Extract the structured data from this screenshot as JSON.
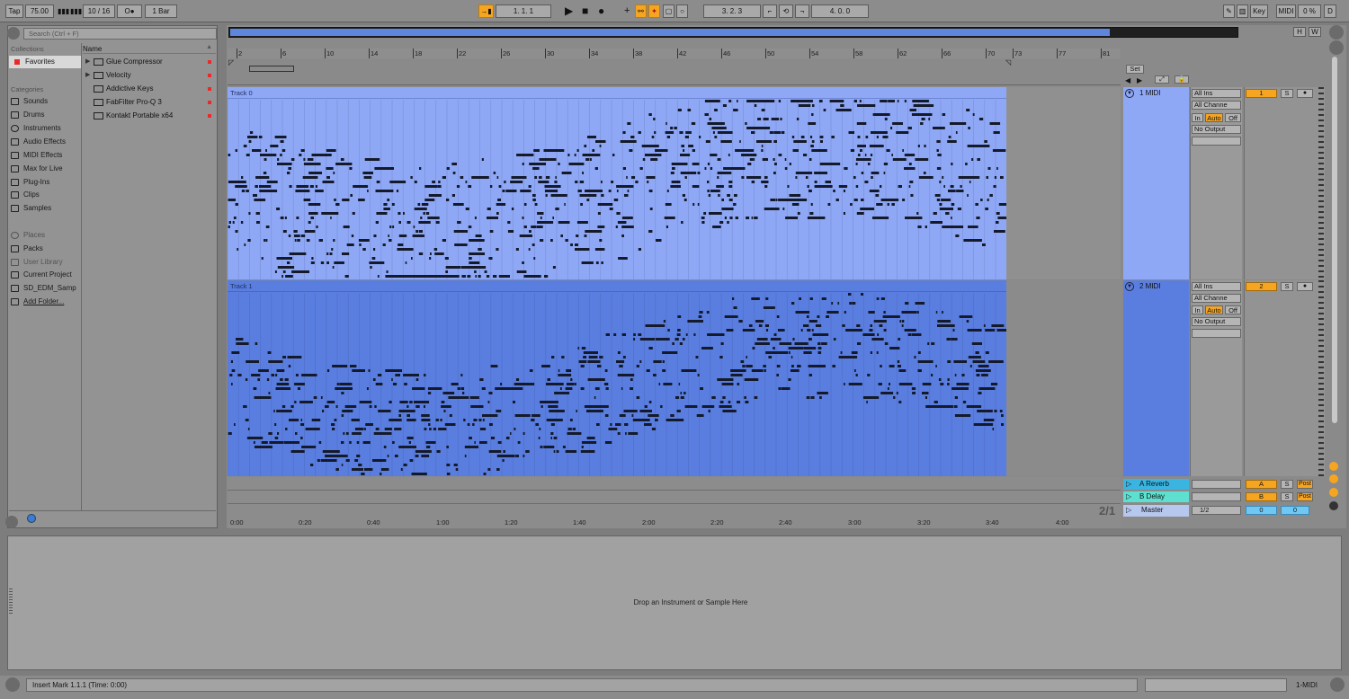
{
  "transport": {
    "tap": "Tap",
    "tempo": "75.00",
    "signature": "10 / 16",
    "metronome": "O●",
    "quantization": "1 Bar",
    "position": "1.   1.   1",
    "loop_start": "3.   2.   3",
    "loop_length": "4.   0.   0",
    "key": "Key",
    "midi": "MIDI",
    "cpu": "0 %",
    "d": "D"
  },
  "browser": {
    "search_placeholder": "Search (Ctrl + F)",
    "collections_title": "Collections",
    "favorites": "Favorites",
    "categories_title": "Categories",
    "categories": [
      "Sounds",
      "Drums",
      "Instruments",
      "Audio Effects",
      "MIDI Effects",
      "Max for Live",
      "Plug-Ins",
      "Clips",
      "Samples"
    ],
    "places_title": "Places",
    "places": [
      "Packs",
      "User Library",
      "Current Project",
      "SD_EDM_Samp",
      "Add Folder..."
    ],
    "name_header": "Name",
    "files": [
      "Glue Compressor",
      "Velocity",
      "Addictive Keys",
      "FabFilter Pro-Q 3",
      "Kontakt Portable x64"
    ]
  },
  "arrangement": {
    "bar_numbers": [
      "2",
      "6",
      "10",
      "14",
      "18",
      "22",
      "26",
      "30",
      "34",
      "38",
      "42",
      "46",
      "50",
      "54",
      "58",
      "62",
      "66",
      "70",
      "73",
      "77",
      "81"
    ],
    "time_labels": [
      "0:00",
      "0:20",
      "0:40",
      "1:00",
      "1:20",
      "1:40",
      "2:00",
      "2:20",
      "2:40",
      "3:00",
      "3:20",
      "3:40",
      "4:00"
    ],
    "clip0_name": "Track 0",
    "clip1_name": "Track 1",
    "zoom_fraction": "2/1",
    "set_button": "Set",
    "hw": [
      "H",
      "W"
    ]
  },
  "tracks": [
    {
      "name": "1 MIDI",
      "input": "All Ins",
      "channel": "All Channe",
      "output": "No Output",
      "number": "1"
    },
    {
      "name": "2 MIDI",
      "input": "All Ins",
      "channel": "All Channe",
      "output": "No Output",
      "number": "2"
    }
  ],
  "monitor": {
    "in": "In",
    "auto": "Auto",
    "off": "Off"
  },
  "solo": "S",
  "returns": [
    {
      "name": "A Reverb",
      "letter": "A",
      "post": "Post",
      "color": "#3ab4e0"
    },
    {
      "name": "B Delay",
      "letter": "B",
      "post": "Post",
      "color": "#5ee0d0"
    }
  ],
  "master": {
    "name": "Master",
    "output": "1/2",
    "vol": "0",
    "pan": "0"
  },
  "detail": {
    "drop_text": "Drop an Instrument or Sample Here"
  },
  "status": {
    "message": "Insert Mark 1.1.1 (Time: 0:00)",
    "track": "1-MIDI"
  },
  "colors": {
    "clip0": "#8fa8f6",
    "clip1": "#5a7ee0",
    "accent": "#f6a521"
  }
}
